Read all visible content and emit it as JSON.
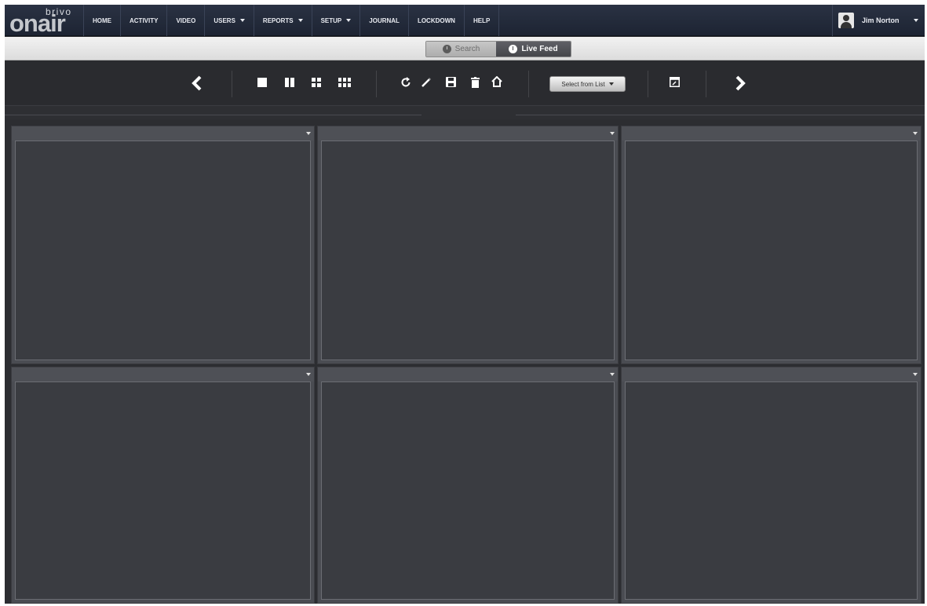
{
  "brand": {
    "top": "brivo",
    "main": "onair"
  },
  "nav": {
    "items": [
      {
        "label": "HOME",
        "dropdown": false
      },
      {
        "label": "ACTIVITY",
        "dropdown": false
      },
      {
        "label": "VIDEO",
        "dropdown": false
      },
      {
        "label": "USERS",
        "dropdown": true
      },
      {
        "label": "REPORTS",
        "dropdown": true
      },
      {
        "label": "SETUP",
        "dropdown": true
      },
      {
        "label": "JOURNAL",
        "dropdown": false
      },
      {
        "label": "LOCKDOWN",
        "dropdown": false
      },
      {
        "label": "HELP",
        "dropdown": false
      }
    ],
    "user_name": "Jim Norton"
  },
  "mode": {
    "search_label": "Search",
    "live_label": "Live Feed",
    "active": "Live Feed"
  },
  "toolbar": {
    "icons": [
      "chevron-left-icon",
      "layout-1x1-icon",
      "layout-2-icon",
      "layout-2x2-icon",
      "layout-3x2-icon",
      "refresh-icon",
      "edit-icon",
      "save-icon",
      "delete-icon",
      "home-icon",
      "popout-icon",
      "chevron-right-icon"
    ],
    "select_label": "Select from List"
  },
  "grid": {
    "rows": 2,
    "cols": 3,
    "panels": [
      "",
      "",
      "",
      "",
      "",
      ""
    ]
  },
  "colors": {
    "nav_bg": "#1d2433",
    "toolbar_bg": "#2a2b2f",
    "panel_bg": "#3a3c41"
  }
}
